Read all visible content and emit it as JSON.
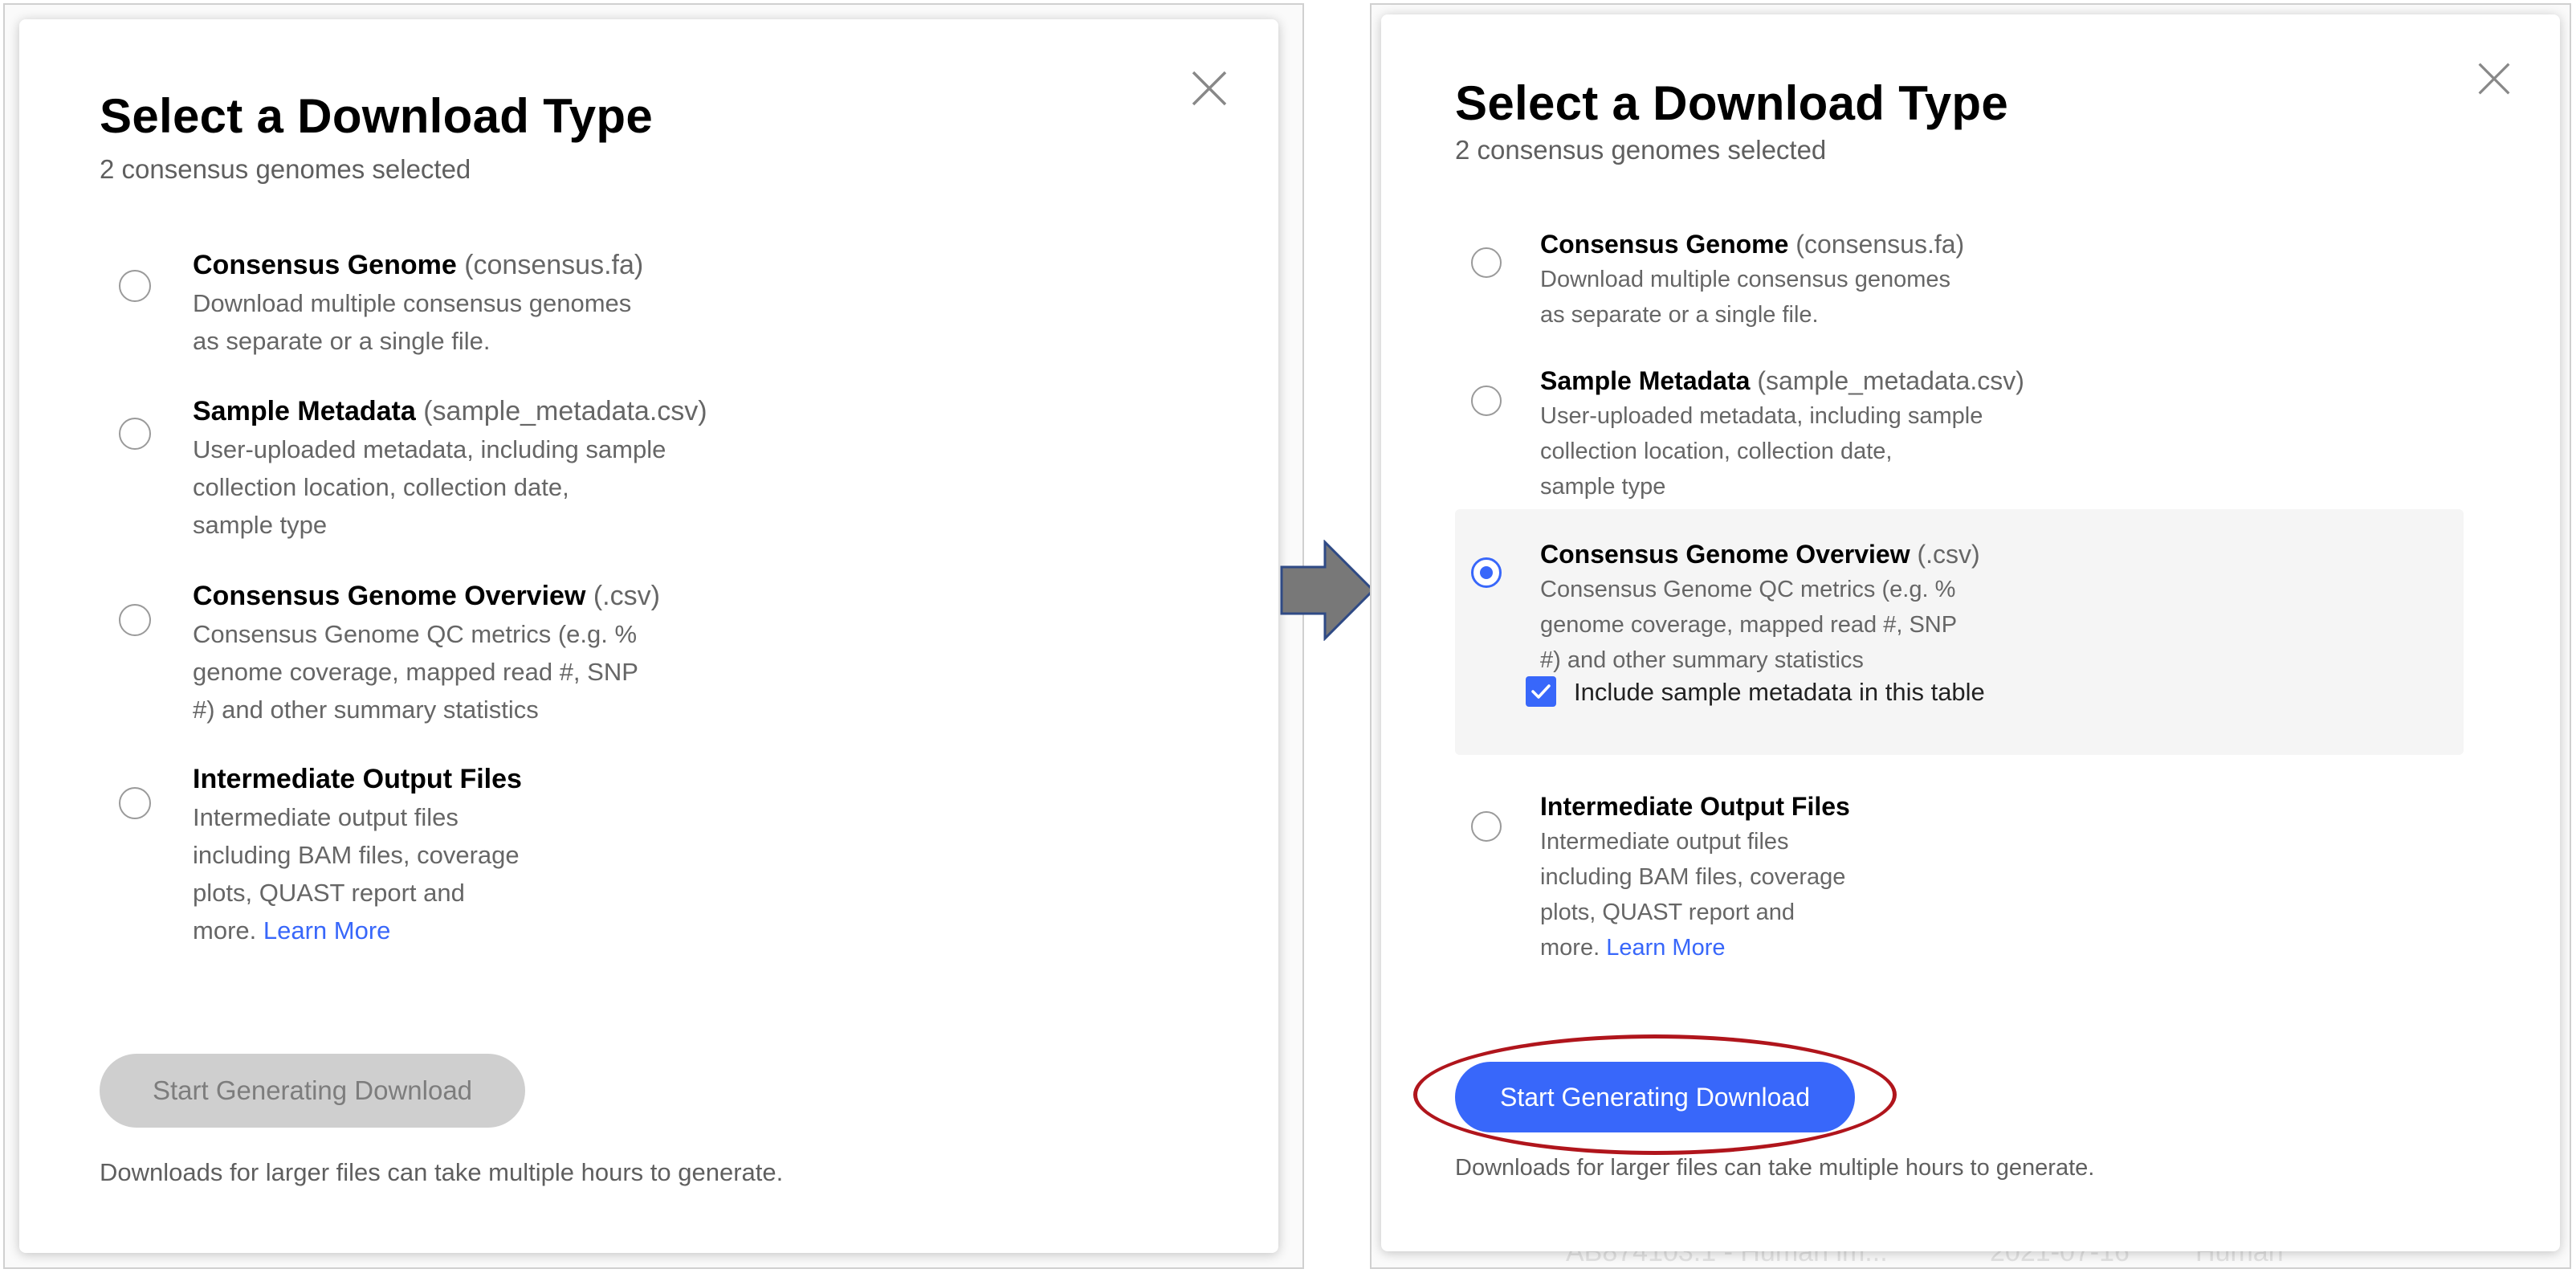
{
  "left_modal": {
    "title": "Select a Download Type",
    "subtitle": "2 consensus genomes selected",
    "options": [
      {
        "name": "Consensus Genome",
        "ext": "(consensus.fa)",
        "desc": "Download multiple consensus genomes as separate or a single file.",
        "selected": false
      },
      {
        "name": "Sample Metadata",
        "ext": "(sample_metadata.csv)",
        "desc_line1": "User-uploaded metadata, including sample collection location, collection date,",
        "desc_line2": "sample type",
        "selected": false
      },
      {
        "name": "Consensus Genome Overview",
        "ext": "(.csv)",
        "desc_line1": "Consensus Genome QC metrics (e.g. % genome coverage, mapped read #, SNP",
        "desc_line2": "#) and other summary statistics",
        "selected": false
      },
      {
        "name": "Intermediate Output Files",
        "desc_line1": "Intermediate output files including BAM files, coverage plots, QUAST report and",
        "desc_line2_prefix": "more.",
        "link": "Learn More",
        "selected": false
      }
    ],
    "button_label": "Start Generating Download",
    "footnote": "Downloads for larger files can take multiple hours to generate."
  },
  "right_modal": {
    "title": "Select a Download Type",
    "subtitle": "2 consensus genomes selected",
    "options": [
      {
        "name": "Consensus Genome",
        "ext": "(consensus.fa)",
        "desc": "Download multiple consensus genomes as separate or a single file.",
        "selected": false
      },
      {
        "name": "Sample Metadata",
        "ext": "(sample_metadata.csv)",
        "desc_line1": "User-uploaded metadata, including sample collection location, collection date,",
        "desc_line2": "sample type",
        "selected": false
      },
      {
        "name": "Consensus Genome Overview",
        "ext": "(.csv)",
        "desc_line1": "Consensus Genome QC metrics (e.g. % genome coverage, mapped read #, SNP",
        "desc_line2": "#) and other summary statistics",
        "selected": true
      },
      {
        "name": "Intermediate Output Files",
        "desc_line1": "Intermediate output files including BAM files, coverage plots, QUAST report and",
        "desc_line2_prefix": "more.",
        "link": "Learn More",
        "selected": false
      }
    ],
    "checkbox_label": "Include sample metadata in this table",
    "checkbox_checked": true,
    "button_label": "Start Generating Download",
    "footnote": "Downloads for larger files can take multiple hours to generate."
  },
  "background": {
    "row_text": "AB874103.1 - Human im...",
    "row_date": "2021-07-16",
    "row_host": "Human"
  },
  "colors": {
    "accent": "#3867fa",
    "highlight_ring": "#b0151c",
    "arrow_fill": "#787878",
    "arrow_stroke": "#2f4a85",
    "disabled_button": "#cfcfcf"
  },
  "icons": [
    "close-icon",
    "check-icon",
    "right-arrow-icon"
  ]
}
